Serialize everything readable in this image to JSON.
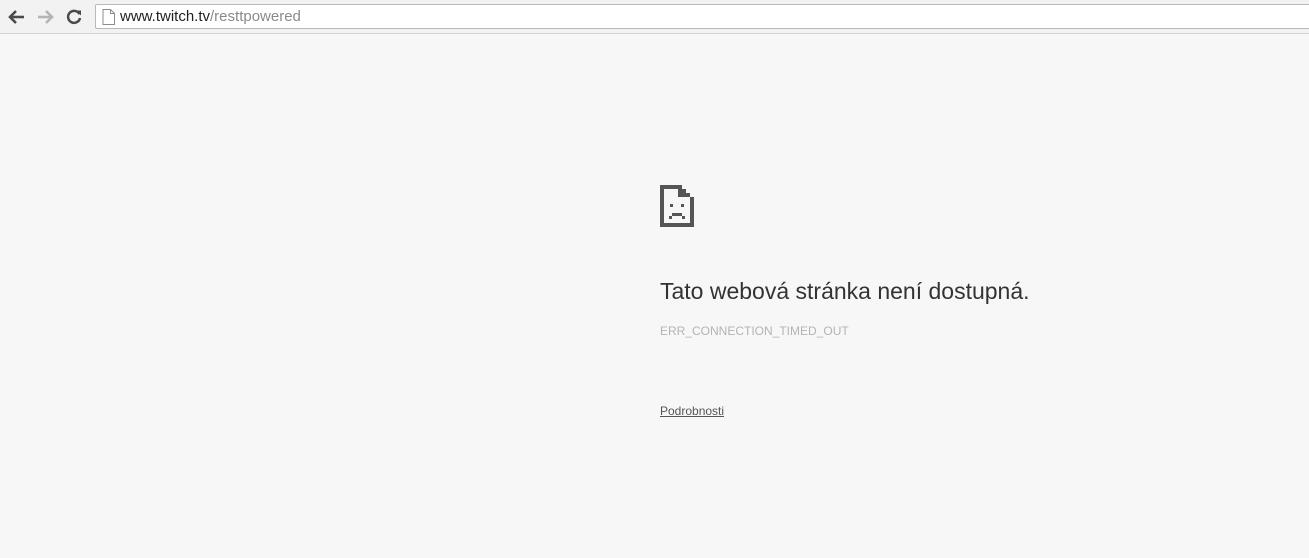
{
  "toolbar": {
    "back_icon": "arrow-left-icon",
    "forward_icon": "arrow-right-icon",
    "reload_icon": "reload-icon",
    "url_host": "www.twitch.tv",
    "url_path": "/resttpowered",
    "page_icon": "page-icon"
  },
  "error_page": {
    "icon": "sad-page-icon",
    "title": "Tato webová stránka není dostupná.",
    "error_code": "ERR_CONNECTION_TIMED_OUT",
    "details_link": "Podrobnosti"
  },
  "colors": {
    "background": "#f7f7f7",
    "title": "#333333",
    "error_code": "#b3b3b3",
    "link": "#555555"
  }
}
